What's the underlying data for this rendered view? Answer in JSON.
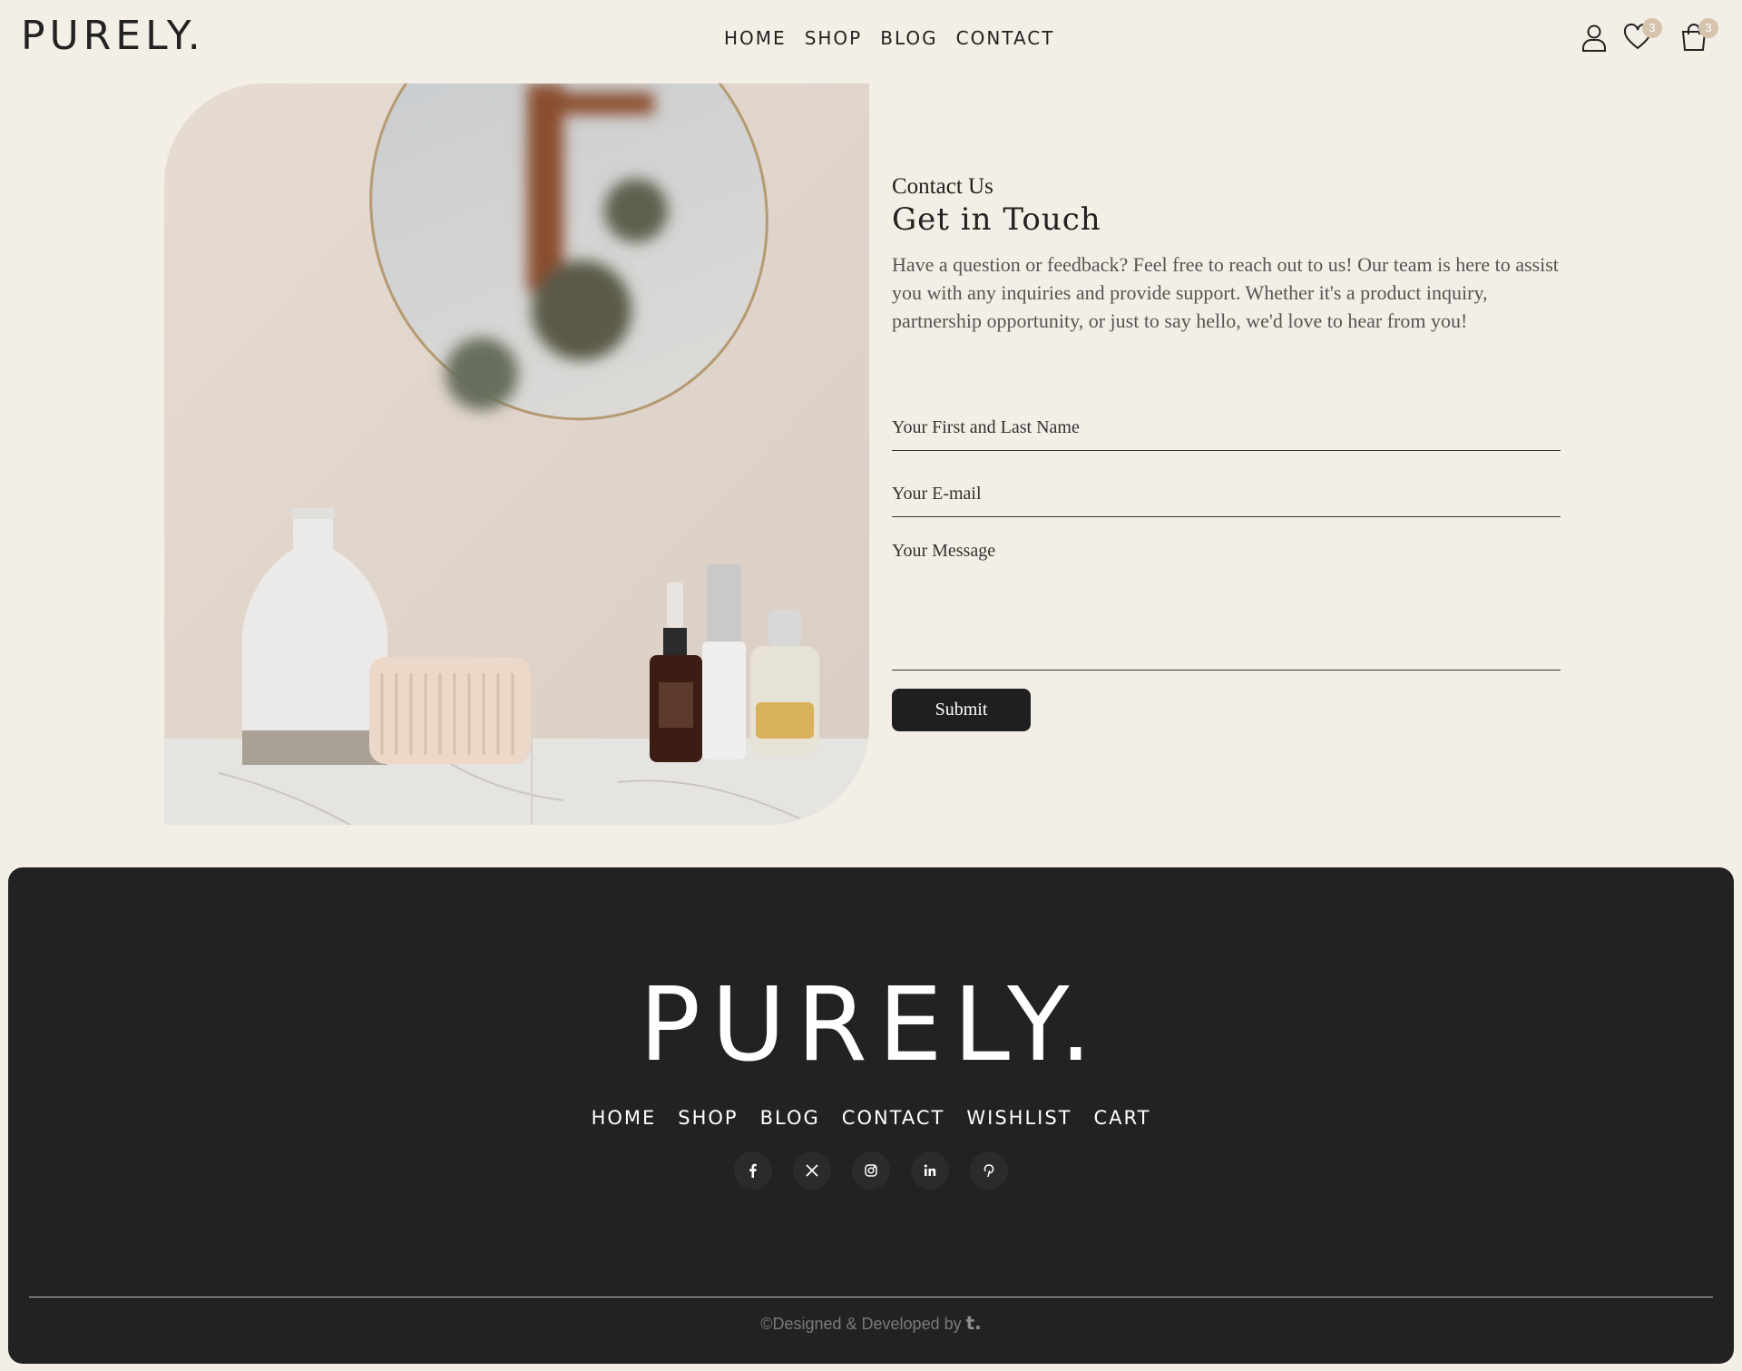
{
  "header": {
    "logo": "PURELY.",
    "nav": [
      "HOME",
      "SHOP",
      "BLOG",
      "CONTACT"
    ],
    "wishlist_count": "3",
    "cart_count": "3"
  },
  "contact": {
    "eyebrow": "Contact Us",
    "title": "Get in Touch",
    "lead": "Have a question or feedback? Feel free to reach out to us! Our team is here to assist you with any inquiries and provide support. Whether it's a product inquiry, partnership opportunity, or just to say hello, we'd love to hear from you!",
    "name_placeholder": "Your First and Last Name",
    "email_placeholder": "Your E-mail",
    "message_placeholder": "Your Message",
    "submit_label": "Submit"
  },
  "footer": {
    "logo": "PURELY.",
    "nav": [
      "HOME",
      "SHOP",
      "BLOG",
      "CONTACT",
      "WISHLIST",
      "CART"
    ],
    "social": [
      "facebook-icon",
      "x-icon",
      "instagram-icon",
      "linkedin-icon",
      "pinterest-icon"
    ],
    "copyright": "©Designed & Developed by",
    "brand_mark": "t."
  },
  "colors": {
    "background": "#f3efe6",
    "footer_bg": "#222222",
    "badge": "#d6c3ad",
    "button": "#1f1f1f"
  }
}
